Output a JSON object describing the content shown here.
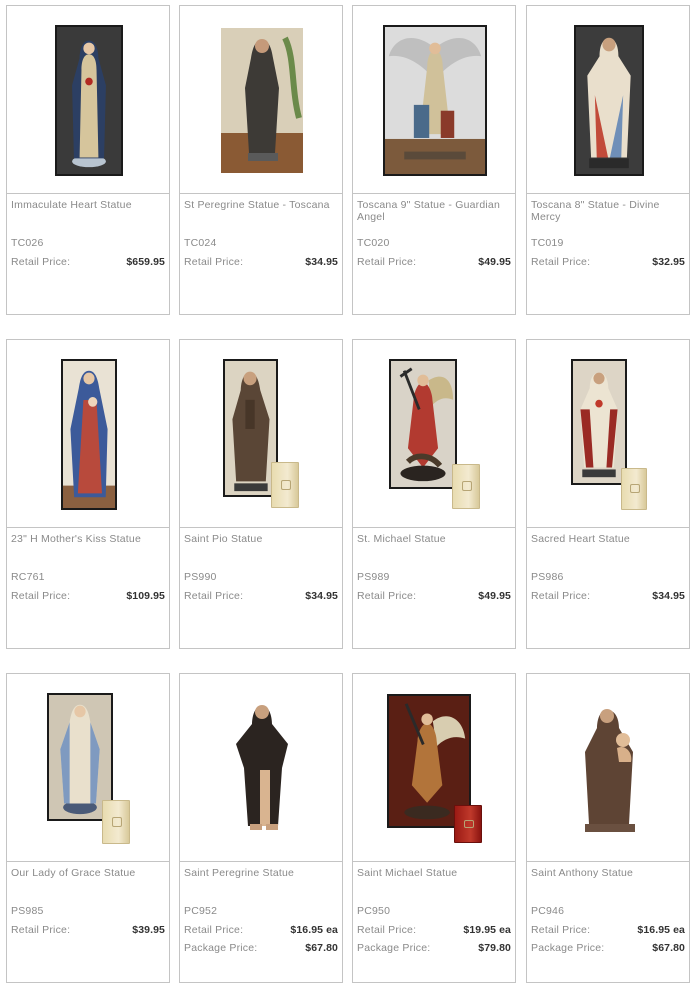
{
  "products": [
    {
      "name": "Immaculate Heart Statue",
      "sku": "TC026",
      "retail_label": "Retail Price:",
      "retail_price": "$659.95",
      "package_label": "",
      "package_price": "",
      "icon": "madonna-statue-icon"
    },
    {
      "name": "St Peregrine Statue - Toscana",
      "sku": "TC024",
      "retail_label": "Retail Price:",
      "retail_price": "$34.95",
      "package_label": "",
      "package_price": "",
      "icon": "saint-statue-icon"
    },
    {
      "name": "Toscana 9\" Statue - Guardian Angel",
      "sku": "TC020",
      "retail_label": "Retail Price:",
      "retail_price": "$49.95",
      "package_label": "",
      "package_price": "",
      "icon": "angel-statue-icon"
    },
    {
      "name": "Toscana 8\" Statue - Divine Mercy",
      "sku": "TC019",
      "retail_label": "Retail Price:",
      "retail_price": "$32.95",
      "package_label": "",
      "package_price": "",
      "icon": "jesus-statue-icon"
    },
    {
      "name": "23\" H Mother's Kiss Statue",
      "sku": "RC761",
      "retail_label": "Retail Price:",
      "retail_price": "$109.95",
      "package_label": "",
      "package_price": "",
      "icon": "madonna-child-statue-icon"
    },
    {
      "name": "Saint Pio Statue",
      "sku": "PS990",
      "retail_label": "Retail Price:",
      "retail_price": "$34.95",
      "package_label": "",
      "package_price": "",
      "icon": "saint-statue-icon"
    },
    {
      "name": "St. Michael Statue",
      "sku": "PS989",
      "retail_label": "Retail Price:",
      "retail_price": "$49.95",
      "package_label": "",
      "package_price": "",
      "icon": "archangel-statue-icon"
    },
    {
      "name": "Sacred Heart Statue",
      "sku": "PS986",
      "retail_label": "Retail Price:",
      "retail_price": "$34.95",
      "package_label": "",
      "package_price": "",
      "icon": "jesus-statue-icon"
    },
    {
      "name": "Our Lady of Grace Statue",
      "sku": "PS985",
      "retail_label": "Retail Price:",
      "retail_price": "$39.95",
      "package_label": "",
      "package_price": "",
      "icon": "madonna-statue-icon"
    },
    {
      "name": "Saint Peregrine Statue",
      "sku": "PC952",
      "retail_label": "Retail Price:",
      "retail_price": "$16.95 ea",
      "package_label": "Package Price:",
      "package_price": "$67.80",
      "icon": "saint-statue-icon"
    },
    {
      "name": "Saint Michael Statue",
      "sku": "PC950",
      "retail_label": "Retail Price:",
      "retail_price": "$19.95 ea",
      "package_label": "Package Price:",
      "package_price": "$79.80",
      "icon": "archangel-statue-icon"
    },
    {
      "name": "Saint Anthony Statue",
      "sku": "PC946",
      "retail_label": "Retail Price:",
      "retail_price": "$16.95 ea",
      "package_label": "Package Price:",
      "package_price": "$67.80",
      "icon": "saint-statue-icon"
    }
  ],
  "colors": {
    "border": "#c4c4c4",
    "label": "#8a8a8a",
    "price": "#333333"
  }
}
